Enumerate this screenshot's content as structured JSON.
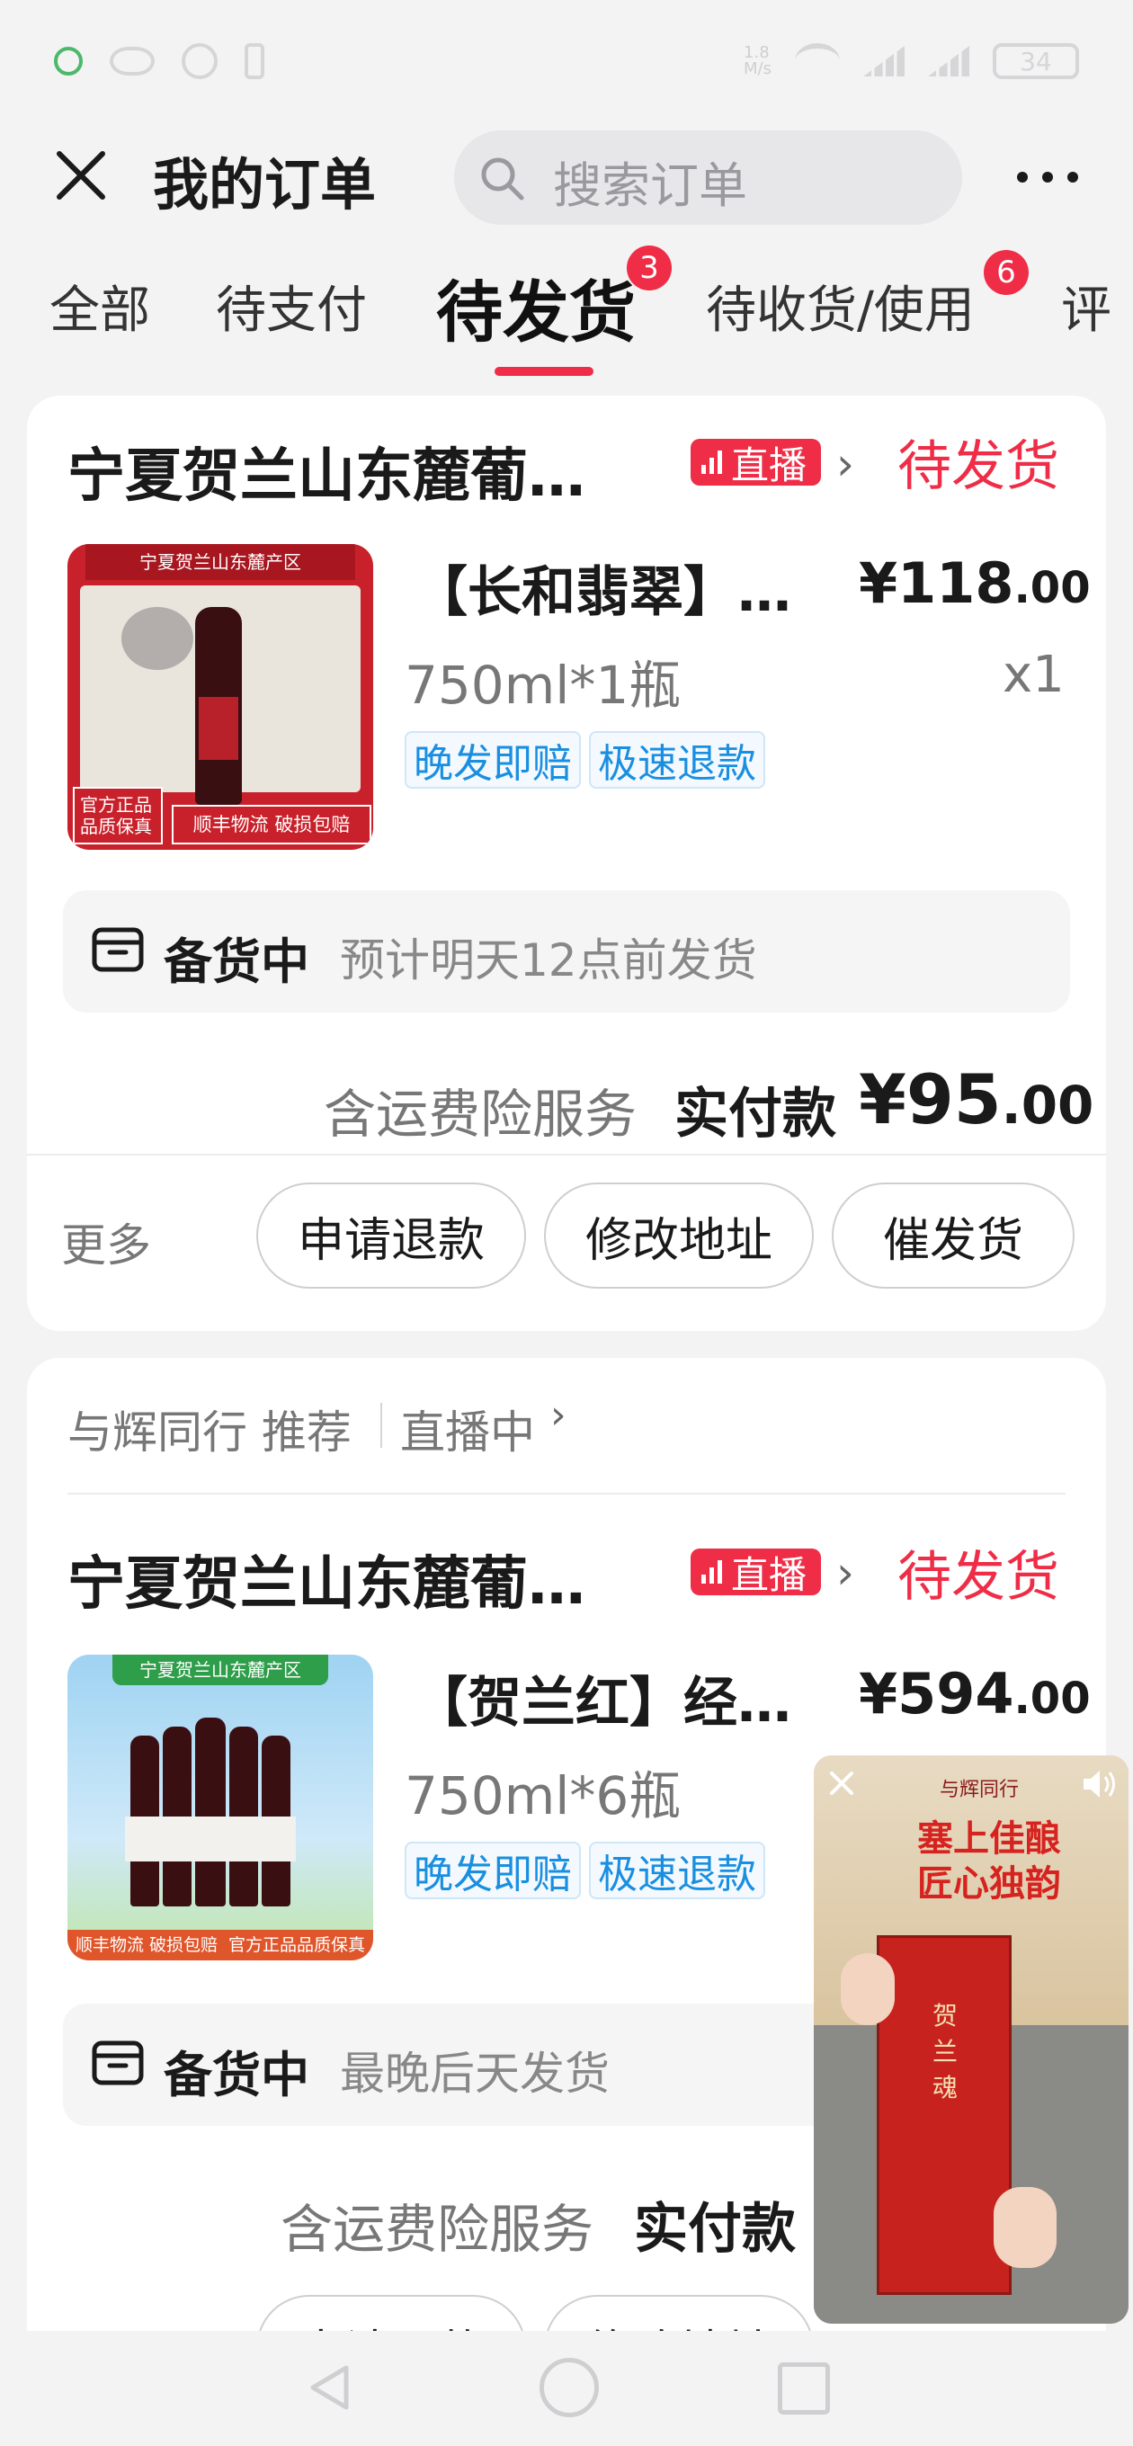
{
  "status_bar": {
    "net_speed": "1.8\nM/s",
    "battery": "34"
  },
  "header": {
    "title": "我的订单",
    "search_placeholder": "搜索订单"
  },
  "tabs": [
    {
      "label": "全部"
    },
    {
      "label": "待支付"
    },
    {
      "label": "待发货",
      "badge": "3",
      "active": true
    },
    {
      "label": "待收货/使用",
      "badge": "6"
    },
    {
      "label": "评"
    }
  ],
  "orders": [
    {
      "store": "宁夏贺兰山东麓葡…",
      "live_label": "直播",
      "status": "待发货",
      "product_name": "【长和翡翠】…",
      "price_int": "¥118",
      "price_dec": ".00",
      "spec": "750ml*1瓶",
      "qty": "x1",
      "tags": [
        "晚发即赔",
        "极速退款"
      ],
      "thumb_banner": "宁夏贺兰山东麓产区",
      "thumb_bottom_left": "官方正品\n品质保真",
      "thumb_bottom_right": "顺丰物流 破损包赔",
      "stock_title": "备货中",
      "stock_sub": "预计明天12点前发货",
      "pay_label": "含运费险服务",
      "pay_strong": "实付款",
      "pay_int": "¥95",
      "pay_dec": ".00",
      "more": "更多",
      "buttons": [
        "申请退款",
        "修改地址",
        "催发货"
      ]
    },
    {
      "recommend": "与辉同行 推荐",
      "live_now": "直播中",
      "store": "宁夏贺兰山东麓葡…",
      "live_label": "直播",
      "status": "待发货",
      "product_name": "【贺兰红】经…",
      "price_int": "¥594",
      "price_dec": ".00",
      "spec": "750ml*6瓶",
      "tags": [
        "晚发即赔",
        "极速退款"
      ],
      "thumb_banner": "宁夏贺兰山东麓产区",
      "thumb_bottom": "顺丰物流 破损包赔  官方正品品质保真",
      "stock_title": "备货中",
      "stock_sub": "最晚后天发货",
      "pay_label": "含运费险服务",
      "pay_strong": "实付款",
      "buttons": [
        "申请退款",
        "修改地址"
      ]
    }
  ],
  "floating_video": {
    "top_text": "与辉同行",
    "headline_1": "塞上佳酿",
    "headline_2": "匠心独韵",
    "box_text": "贺 兰 魂"
  },
  "colors": {
    "accent": "#ef2d47",
    "tag_blue": "#1a8fe0"
  }
}
